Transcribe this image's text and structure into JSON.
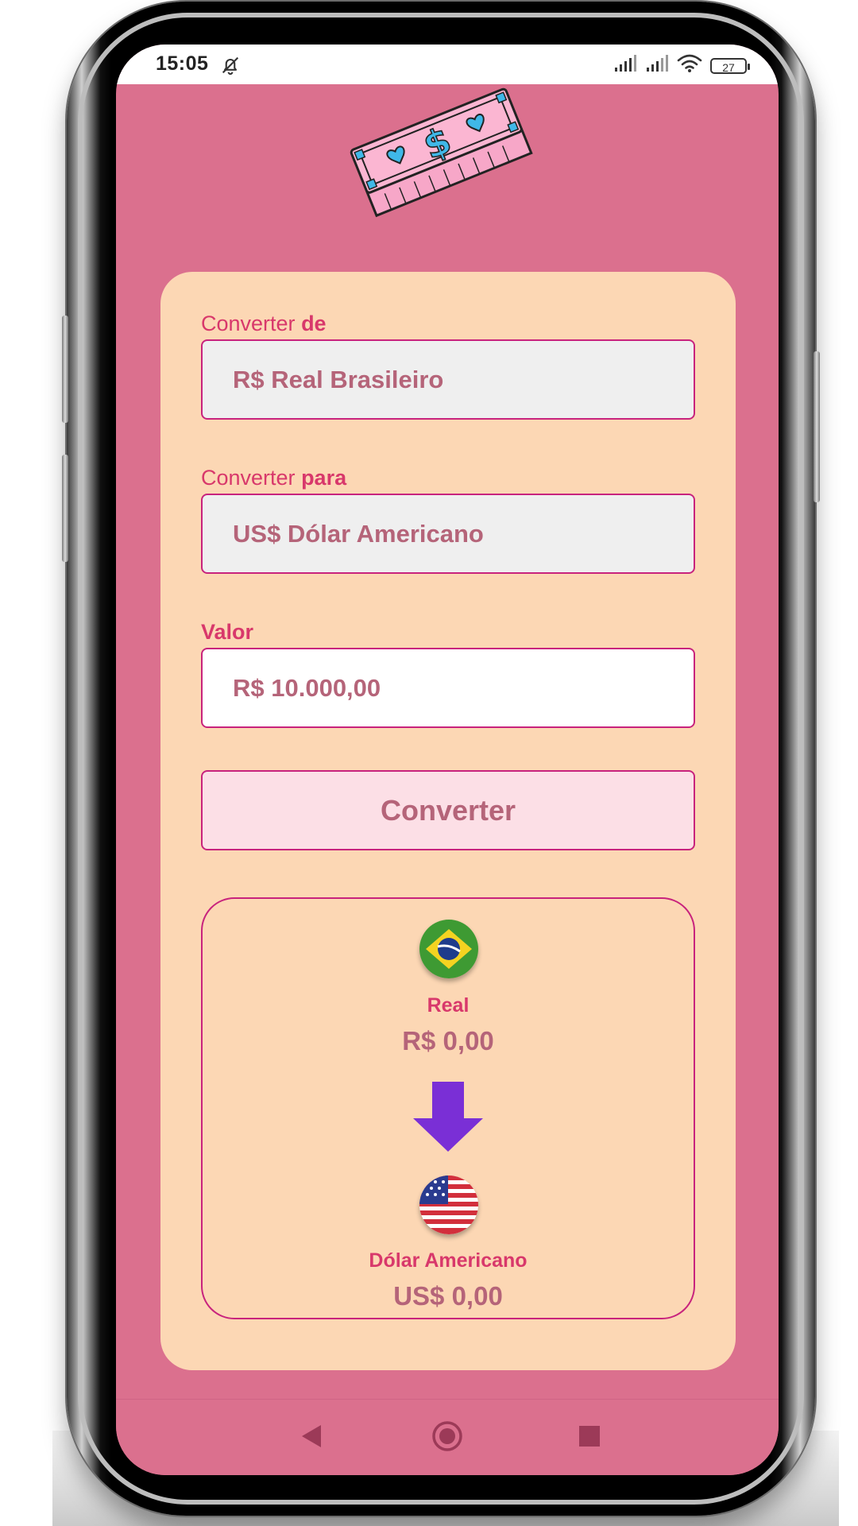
{
  "status_bar": {
    "time": "15:05",
    "battery_level": "27",
    "icons": [
      "bell-off-icon",
      "signal-icon",
      "signal-icon",
      "wifi-icon",
      "battery-icon"
    ]
  },
  "header": {
    "illustration": "money-bill-stack-icon"
  },
  "form": {
    "from_label_prefix": "Converter ",
    "from_label_strong": "de",
    "from_value": "R$ Real Brasileiro",
    "to_label_prefix": "Converter ",
    "to_label_strong": "para",
    "to_value": "US$ Dólar Americano",
    "amount_label": "Valor",
    "amount_value": "R$ 10.000,00",
    "convert_button": "Converter"
  },
  "result": {
    "from_currency_name": "Real",
    "from_currency_value": "R$ 0,00",
    "from_flag": "brazil-flag-icon",
    "arrow": "arrow-down-icon",
    "to_currency_name": "Dólar Americano",
    "to_currency_value": "US$ 0,00",
    "to_flag": "usa-flag-icon"
  },
  "nav_bar": {
    "buttons": [
      "back-icon",
      "home-icon",
      "recents-icon"
    ]
  },
  "colors": {
    "background": "#db708e",
    "card": "#fcd7b4",
    "accent": "#d8386b",
    "border": "#c8237d",
    "value_text": "#b56479",
    "arrow": "#7a2fd6"
  }
}
